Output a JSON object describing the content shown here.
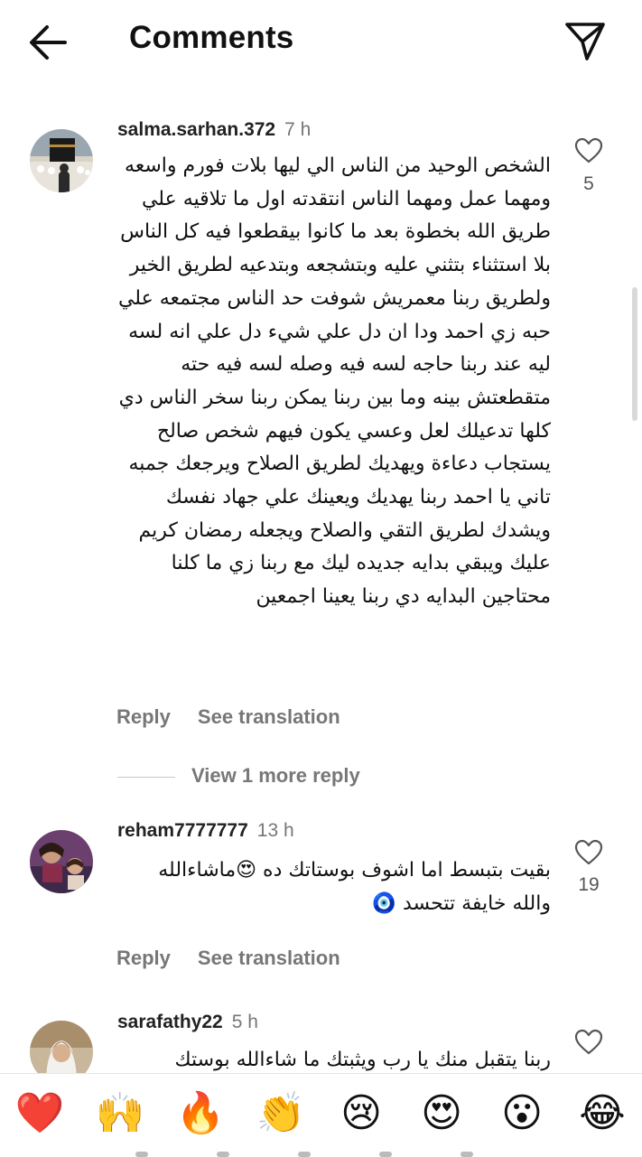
{
  "header": {
    "title": "Comments",
    "back_icon": "arrow-left-icon",
    "send_icon": "send-icon"
  },
  "comments": [
    {
      "username": "salma.sarhan.372",
      "time": "7 h",
      "text": "الشخص الوحيد من الناس الي ليها بلات فورم واسعه ومهما عمل ومهما الناس انتقدته اول ما تلاقيه علي طريق الله بخطوة بعد ما كانوا بيقطعوا فيه كل الناس بلا استثناء بتثني عليه وبتشجعه وبتدعيه لطريق الخير ولطريق ربنا معمريش شوفت حد الناس مجتمعه علي حبه زي احمد ودا ان دل علي شيء دل علي انه لسه ليه عند ربنا حاجه لسه فيه وصله لسه فيه حته متقطعتش بينه وما بين ربنا يمكن ربنا سخر الناس دي كلها تدعيلك لعل وعسي يكون فيهم شخص صالح يستجاب دعاءة ويهديك لطريق الصلاح ويرجعك جمبه تاني يا احمد ربنا يهديك ويعينك علي جهاد نفسك ويشدك لطريق التقي والصلاح ويجعله رمضان كريم عليك ويبقي بدايه جديده ليك مع ربنا زي ما كلنا محتاجين البدايه دي ربنا يعينا اجمعين",
      "likes": "5",
      "reply": "Reply",
      "translate": "See translation"
    },
    {
      "username": "reham7777777",
      "time": "13 h",
      "text": "بقيت بتبسط اما اشوف بوستاتك ده 😍ماشاءالله والله خايفة تتحسد 🧿",
      "likes": "19",
      "reply": "Reply",
      "translate": "See translation"
    },
    {
      "username": "sarafathy22",
      "time": "5 h",
      "text": "ربنا يتقبل منك يا رب ويثبتك ما شاءالله بوستك"
    }
  ],
  "view_more": "View 1 more reply",
  "reactions": [
    "❤️",
    "🙌",
    "🔥",
    "👏",
    "😢",
    "😍",
    "😮",
    "😂"
  ],
  "colors": {
    "text": "#111111",
    "secondary": "#777777",
    "heart_red": "#e0263a"
  }
}
